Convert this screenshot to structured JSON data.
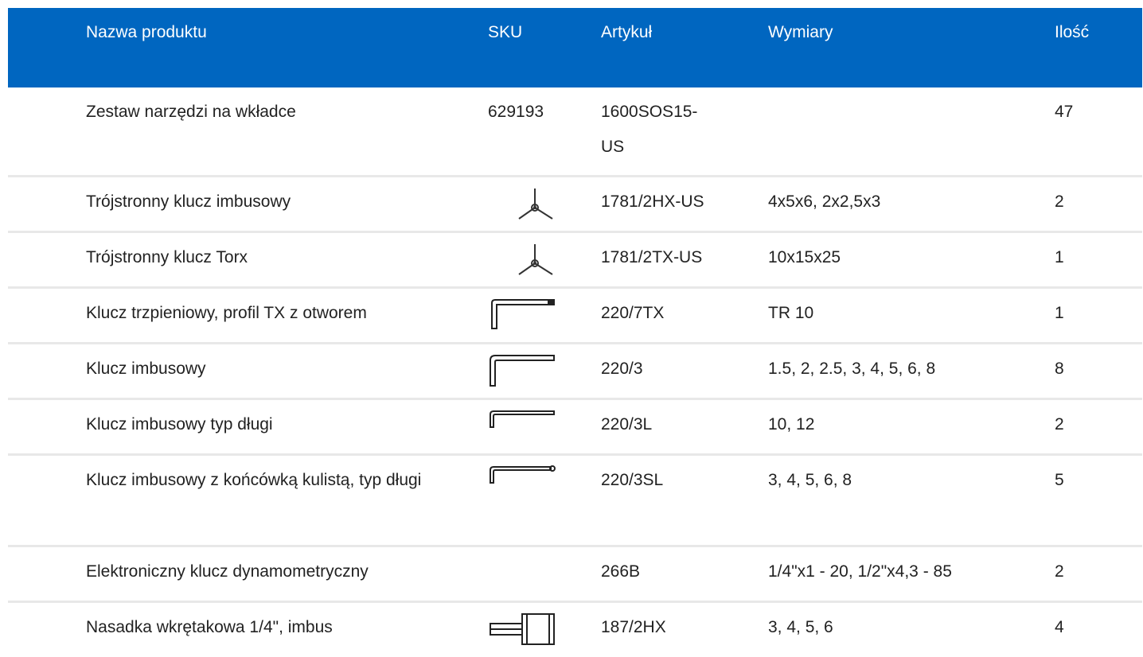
{
  "header": {
    "name": "Nazwa produktu",
    "sku": "SKU",
    "article": "Artykuł",
    "dimensions": "Wymiary",
    "quantity": "Ilość"
  },
  "rows": [
    {
      "name": "Zestaw narzędzi na wkładce",
      "sku": "629193",
      "article": "1600SOS15-US",
      "dimensions": "",
      "quantity": "47",
      "icon": ""
    },
    {
      "name": "Trójstronny klucz imbusowy",
      "sku": "",
      "article": "1781/2HX-US",
      "dimensions": "4x5x6, 2x2,5x3",
      "quantity": "2",
      "icon": "y-key-icon"
    },
    {
      "name": "Trójstronny klucz Torx",
      "sku": "",
      "article": "1781/2TX-US",
      "dimensions": "10x15x25",
      "quantity": "1",
      "icon": "y-key-icon"
    },
    {
      "name": "Klucz trzpieniowy, profil TX z otworem",
      "sku": "",
      "article": "220/7TX",
      "dimensions": "TR 10",
      "quantity": "1",
      "icon": "l-key-tx-icon"
    },
    {
      "name": "Klucz imbusowy",
      "sku": "",
      "article": "220/3",
      "dimensions": "1.5, 2, 2.5, 3, 4, 5, 6, 8",
      "quantity": "8",
      "icon": "l-key-icon"
    },
    {
      "name": "Klucz imbusowy typ długi",
      "sku": "",
      "article": "220/3L",
      "dimensions": "10, 12",
      "quantity": "2",
      "icon": "l-key-long-icon"
    },
    {
      "name": "Klucz imbusowy z końcówką kulistą, typ długi",
      "sku": "",
      "article": "220/3SL",
      "dimensions": "3, 4, 5, 6, 8",
      "quantity": "5",
      "icon": "l-key-ball-icon"
    },
    {
      "name": "Elektroniczny klucz dynamometryczny",
      "sku": "",
      "article": "266B",
      "dimensions": "1/4\"x1 - 20, 1/2\"x4,3 - 85",
      "quantity": "2",
      "icon": ""
    },
    {
      "name": "Nasadka wkrętakowa 1/4\", imbus",
      "sku": "",
      "article": "187/2HX",
      "dimensions": "3, 4, 5, 6",
      "quantity": "4",
      "icon": "socket-bit-icon"
    }
  ]
}
